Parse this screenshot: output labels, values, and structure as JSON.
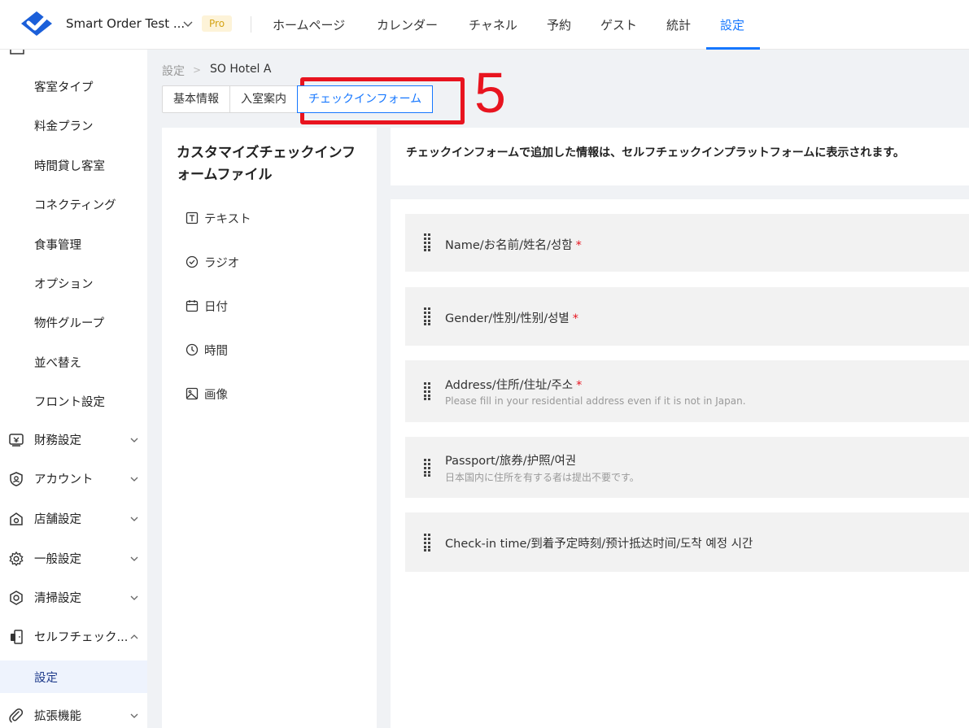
{
  "header": {
    "hotel_name": "Smart Order Test ...",
    "badge": "Pro",
    "nav": [
      "ホームページ",
      "カレンダー",
      "チャネル",
      "予約",
      "ゲスト",
      "統計",
      "設定"
    ],
    "active_nav": "設定"
  },
  "sidebar": {
    "sub_items": [
      "客室タイプ",
      "料金プラン",
      "時間貸し客室",
      "コネクティング",
      "食事管理",
      "オプション",
      "物件グループ",
      "並べ替え",
      "フロント設定"
    ],
    "groups": [
      {
        "label": "財務設定",
        "icon": "finance-icon"
      },
      {
        "label": "アカウント",
        "icon": "account-shield-icon"
      },
      {
        "label": "店舗設定",
        "icon": "store-icon"
      },
      {
        "label": "一般設定",
        "icon": "gear-icon"
      },
      {
        "label": "清掃設定",
        "icon": "cleaning-icon"
      },
      {
        "label": "セルフチェック...",
        "icon": "self-checkin-icon"
      },
      {
        "label": "拡張機能",
        "icon": "paperclip-icon"
      }
    ],
    "selected_item": "設定"
  },
  "breadcrumb": {
    "root": "設定",
    "current": "SO Hotel A"
  },
  "tabs": [
    "基本情報",
    "入室案内",
    "チェックインフォーム"
  ],
  "active_tab": "チェックインフォーム",
  "annotation": {
    "step_number": "5",
    "color": "#e8141f"
  },
  "palette": {
    "title": "カスタマイズチェックインフォームファイル",
    "items": [
      {
        "label": "テキスト",
        "icon": "text-icon"
      },
      {
        "label": "ラジオ",
        "icon": "radio-check-icon"
      },
      {
        "label": "日付",
        "icon": "calendar-icon"
      },
      {
        "label": "時間",
        "icon": "clock-icon"
      },
      {
        "label": "画像",
        "icon": "image-icon"
      }
    ]
  },
  "info_message": "チェックインフォームで追加した情報は、セルフチェックインプラットフォームに表示されます。",
  "fields": [
    {
      "name": "Name/お名前/姓名/성함",
      "required": true,
      "desc": ""
    },
    {
      "name": "Gender/性別/性别/성별",
      "required": true,
      "desc": ""
    },
    {
      "name": "Address/住所/住址/주소",
      "required": true,
      "desc": "Please fill in your residential address even if it is not in Japan."
    },
    {
      "name": "Passport/旅券/护照/여권",
      "required": false,
      "desc": "日本国内に住所を有する者は提出不要です。"
    },
    {
      "name": "Check-in time/到着予定時刻/预计抵达时间/도착 예정 시간",
      "required": false,
      "desc": ""
    }
  ],
  "required_mark": "*",
  "colors": {
    "accent": "#1677ff",
    "annotation_red": "#e8141f",
    "selected_bg": "#eef3fd"
  }
}
